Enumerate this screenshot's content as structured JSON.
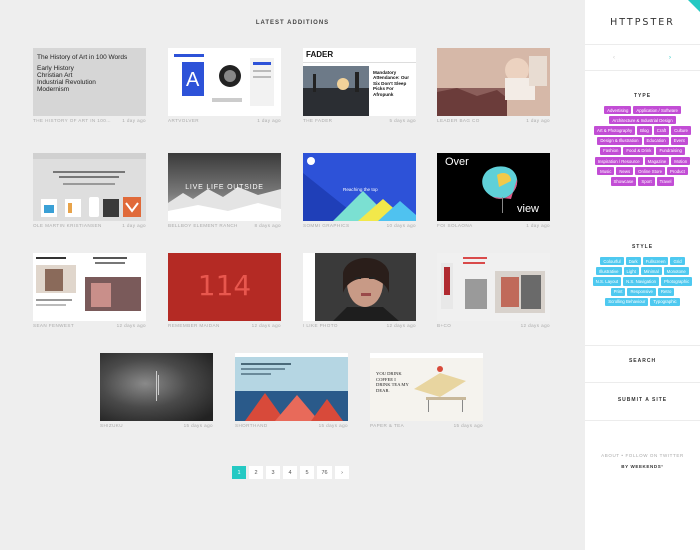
{
  "main": {
    "section_title": "LATEST ADDITIONS",
    "sites": [
      {
        "name": "The History of Art in 100 Words",
        "age": "1 day ago"
      },
      {
        "name": "Artvolver",
        "age": "1 day ago"
      },
      {
        "name": "The Fader",
        "age": "5 days ago"
      },
      {
        "name": "Leader Bag Co",
        "age": "1 day ago"
      },
      {
        "name": "Ole Martin Kristiansen",
        "age": "1 day ago"
      },
      {
        "name": "Bellboy Element Ranch",
        "age": "8 days ago"
      },
      {
        "name": "Sommi Graphics",
        "age": "10 days ago"
      },
      {
        "name": "Foi Solaona",
        "age": "1 day ago"
      },
      {
        "name": "Sean Fenwest",
        "age": "12 days ago"
      },
      {
        "name": "Remember Maidan",
        "age": "12 days ago"
      },
      {
        "name": "I Like Photo",
        "age": "12 days ago"
      },
      {
        "name": "B+CO",
        "age": "12 days ago"
      },
      {
        "name": "Shizuku",
        "age": "15 days ago"
      },
      {
        "name": "Shorthand",
        "age": "15 days ago"
      },
      {
        "name": "Paper & Tea",
        "age": "15 days ago"
      }
    ],
    "thumb_text": {
      "history_title": "The History of Art in 100 Words",
      "history_lines": "Early History\nChristian Art\nIndustrial Revolution\nModernism",
      "fader_logo": "FADER",
      "fader_headline": "Mandatory Attendance: Our Six Don't Sleep Picks For Afropunk",
      "bellboy_headline": "LIVE LIFE OUTSIDE",
      "sommi_text": "Reaching the top",
      "foi_over": "Over",
      "foi_view": "view",
      "remember_number": "114",
      "paper_text": "YOU DRINK COFFEE I DRINK TEA MY DEAR."
    },
    "pagination": [
      "1",
      "2",
      "3",
      "4",
      "5",
      "76"
    ],
    "active_page": "1",
    "next_symbol": "›"
  },
  "sidebar": {
    "logo": "HTTPSTER",
    "prev_symbol": "‹",
    "next_symbol": "›",
    "type_heading": "TYPE",
    "type_tags": [
      "Advertising",
      "Application / Software",
      "Architecture & Industrial Design",
      "Art & Photography",
      "Blog",
      "Craft",
      "Culture",
      "Design & Illustration",
      "Education",
      "Event",
      "Fashion",
      "Food & Drink",
      "Fundraising",
      "Inspiration / Resource",
      "Magazine",
      "Motion",
      "Music",
      "News",
      "Online Store",
      "Product",
      "Showcase",
      "Sport",
      "Travel"
    ],
    "style_heading": "STYLE",
    "style_tags": [
      "Colourful",
      "Dark",
      "Fullscreen",
      "Grid",
      "Illustrative",
      "Light",
      "Minimal",
      "Monotone",
      "N.S. Layout",
      "N.S. Navigation",
      "Photographic",
      "Print",
      "Responsive",
      "Retro",
      "Scrolling Behaviour",
      "Typographic"
    ],
    "search_label": "SEARCH",
    "submit_label": "SUBMIT A SITE",
    "about_text": "ABOUT • FOLLOW ON TWITTER",
    "by_text": "BY WEEKENDS°"
  },
  "colors": {
    "accent": "#25c9c3",
    "type_tag": "#c24dd5",
    "style_tag": "#4ec9f0"
  }
}
